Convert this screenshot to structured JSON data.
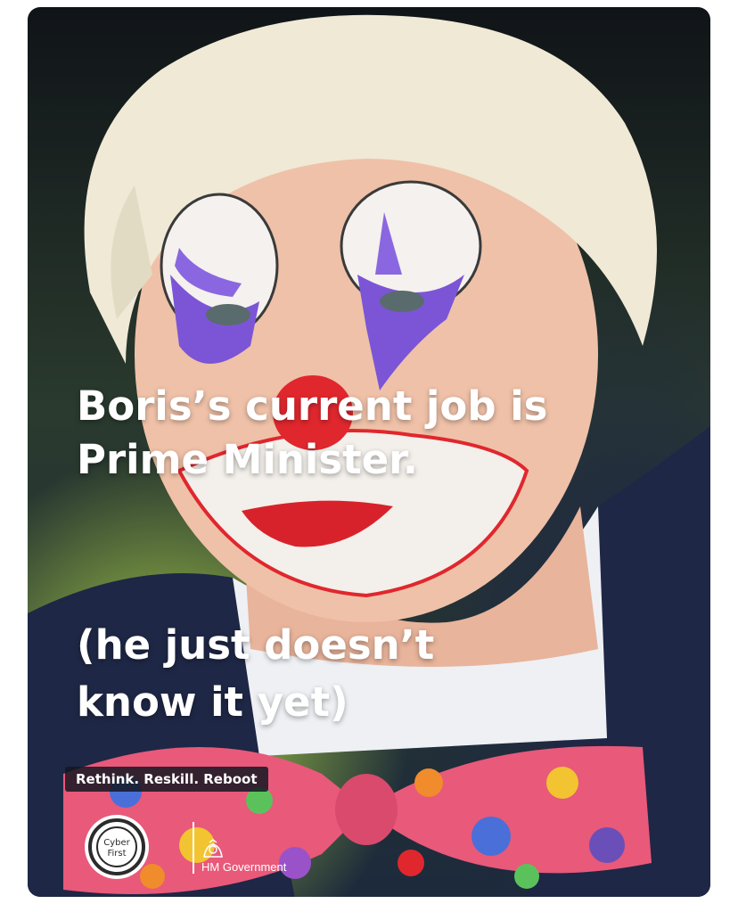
{
  "meme": {
    "headline": "Boris’s current job is Prime Minister.",
    "subline": "(he just doesn’t\nknow it yet)",
    "tagline": "Rethink. Reskill. Reboot",
    "logo_left_text": "Cyber First",
    "logo_right_text": "HM Government"
  },
  "colors": {
    "text": "#ffffff",
    "face_paint_purple": "#7b55d6",
    "face_paint_red": "#e0272e",
    "jacket": "#1e2745",
    "background_green": "#b7e04a"
  },
  "icons": {
    "logo_left": "cyber-first-logo",
    "logo_right": "hm-government-crest-icon"
  }
}
